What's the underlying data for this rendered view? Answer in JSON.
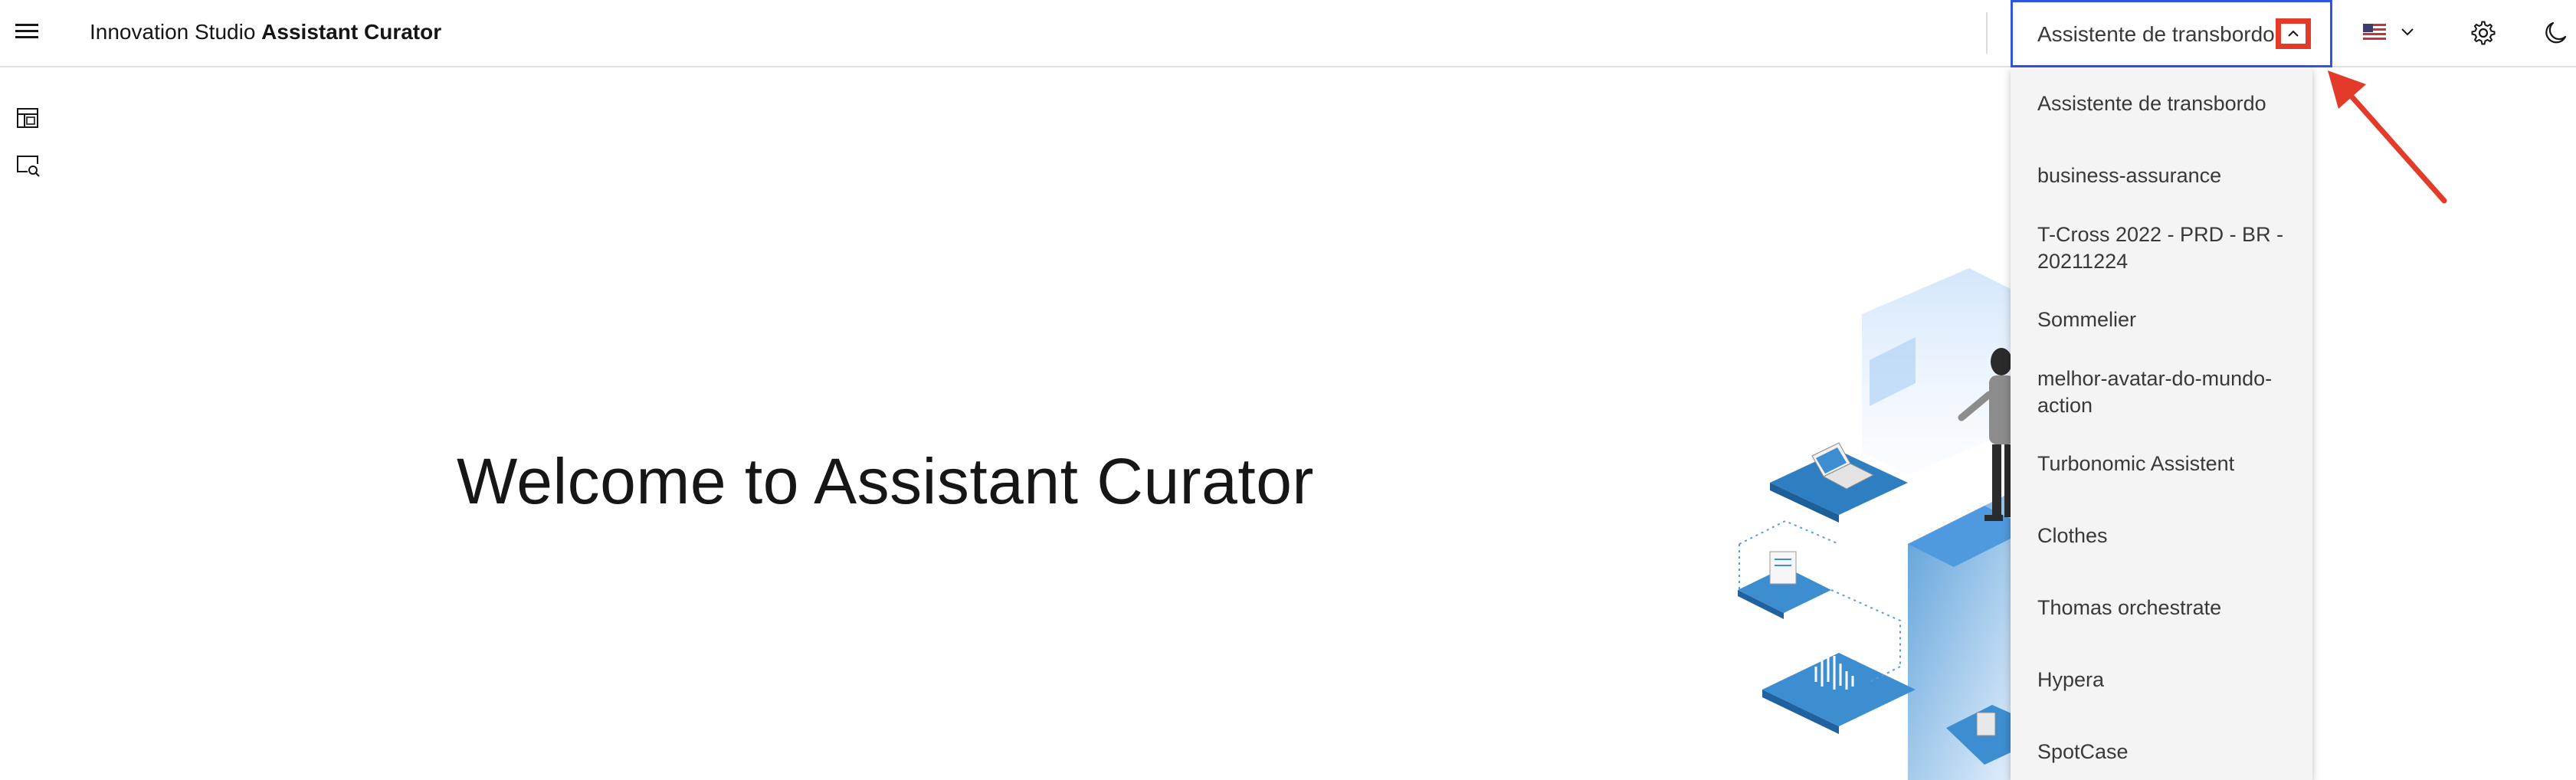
{
  "header": {
    "brand_prefix": "Innovation Studio",
    "brand_name": "Assistant Curator",
    "assistant_selector": {
      "selected": "Assistente de transbordo"
    },
    "icons": [
      "menu-icon",
      "us-flag-icon",
      "chevron-down-icon",
      "settings-icon",
      "moon-icon"
    ]
  },
  "sidebar": {
    "icons": [
      "calendar-table-icon",
      "search-screen-icon"
    ]
  },
  "dropdown": {
    "items": [
      {
        "label": "Assistente de transbordo"
      },
      {
        "label": "business-assurance"
      },
      {
        "label": "T-Cross 2022 - PRD - BR - 20211224"
      },
      {
        "label": "Sommelier"
      },
      {
        "label": "melhor-avatar-do-mundo-action"
      },
      {
        "label": "Turbonomic Assistent"
      },
      {
        "label": "Clothes"
      },
      {
        "label": "Thomas orchestrate"
      },
      {
        "label": "Hypera"
      },
      {
        "label": "SpotCase"
      }
    ]
  },
  "main": {
    "welcome": "Welcome to Assistant Curator"
  },
  "colors": {
    "selector_border": "#2f56e0",
    "highlight": "#e43a2a",
    "dropdown_bg": "#f4f4f4",
    "illustration_blue": "#3d8ed1"
  }
}
